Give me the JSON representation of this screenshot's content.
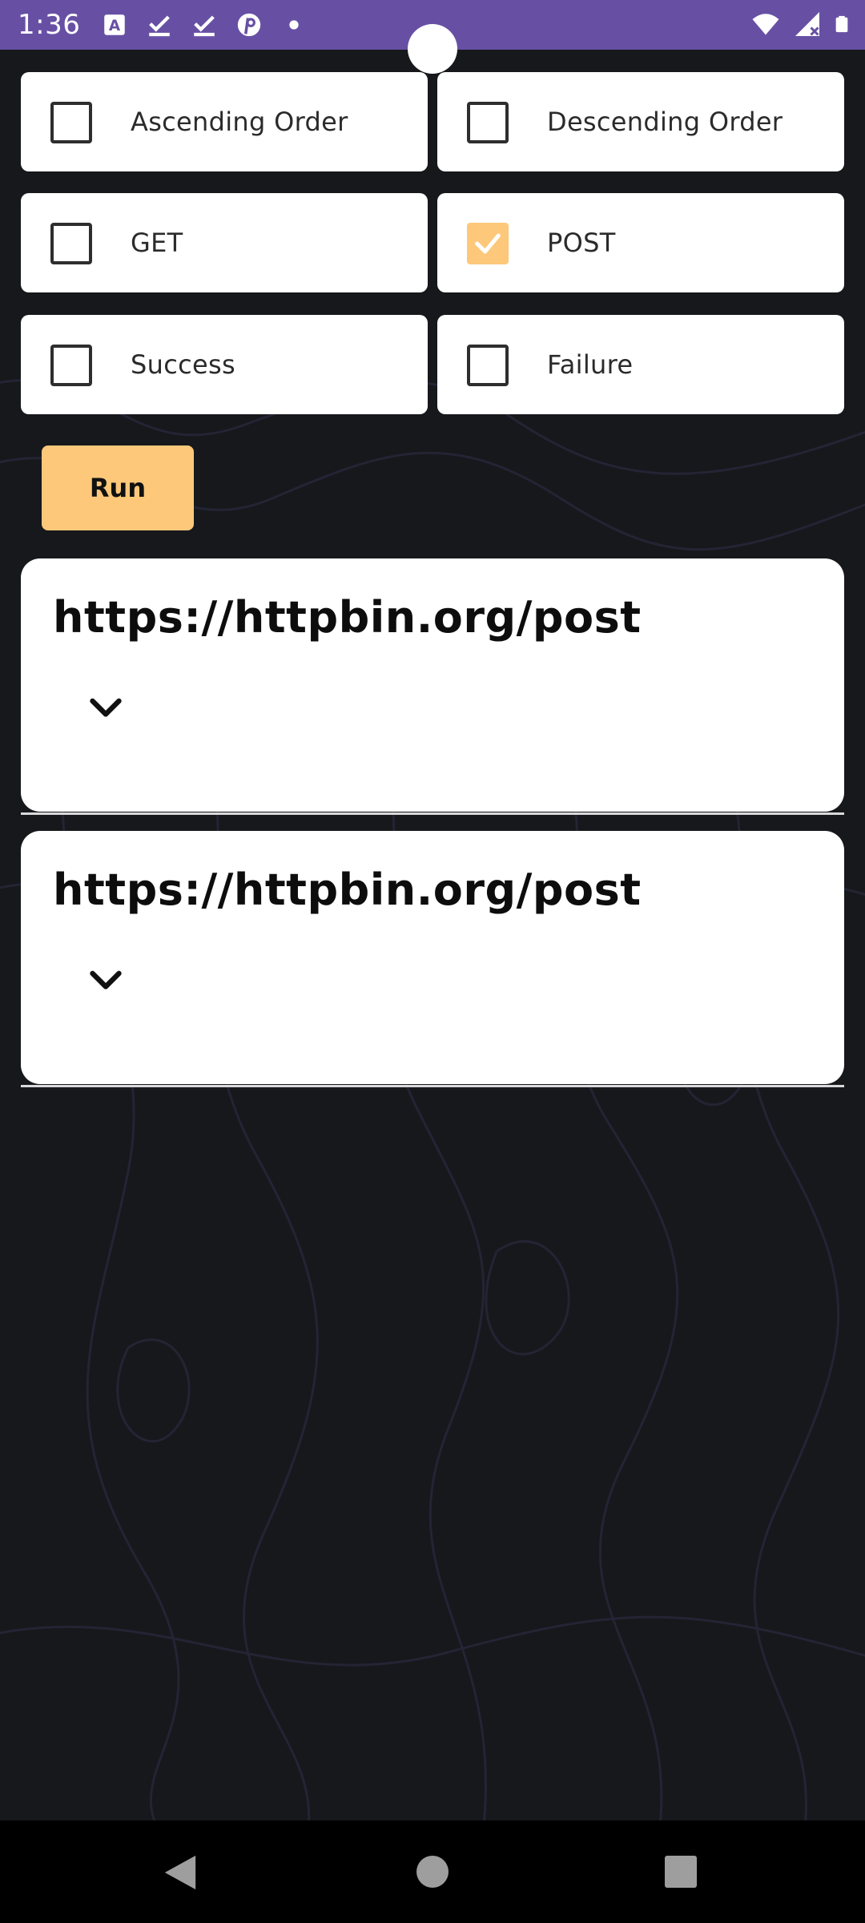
{
  "status_bar": {
    "time": "1:36",
    "notification_icons": [
      "text-a-icon",
      "checkmark-download-icon",
      "checkmark-download-icon",
      "pinterest-icon",
      "dot-icon"
    ],
    "system_icons": [
      "wifi-icon",
      "signal-icon",
      "battery-icon"
    ]
  },
  "filters": [
    {
      "label": "Ascending Order",
      "checked": false
    },
    {
      "label": "Descending Order",
      "checked": false
    },
    {
      "label": "GET",
      "checked": false
    },
    {
      "label": "POST",
      "checked": true
    },
    {
      "label": "Success",
      "checked": false
    },
    {
      "label": "Failure",
      "checked": false
    }
  ],
  "run_button": {
    "label": "Run"
  },
  "requests": [
    {
      "url": "https://httpbin.org/post"
    },
    {
      "url": "https://httpbin.org/post"
    }
  ],
  "colors": {
    "status_bar": "#6750a4",
    "background": "#17181c",
    "accent": "#fdc87a",
    "card": "#ffffff"
  }
}
